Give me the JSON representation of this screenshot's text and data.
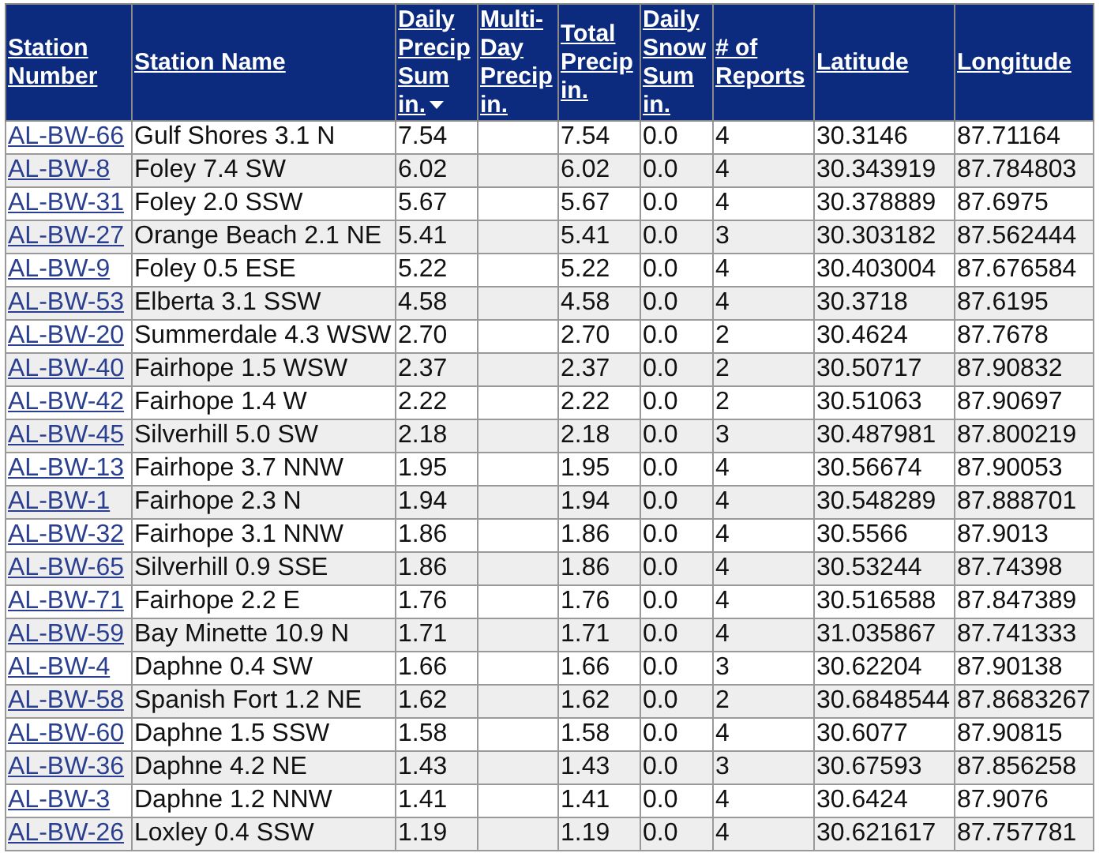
{
  "table": {
    "columns": [
      {
        "label": "Station Number",
        "sorted": false
      },
      {
        "label": "Station Name",
        "sorted": false
      },
      {
        "label": "Daily Precip Sum in.",
        "sorted": true
      },
      {
        "label": "Multi-Day Precip in.",
        "sorted": false
      },
      {
        "label": "Total Precip in.",
        "sorted": false
      },
      {
        "label": "Daily Snow Sum in.",
        "sorted": false
      },
      {
        "label": "# of Reports",
        "sorted": false
      },
      {
        "label": "Latitude",
        "sorted": false
      },
      {
        "label": "Longitude",
        "sorted": false
      }
    ],
    "rows": [
      [
        "AL-BW-66",
        "Gulf Shores 3.1 N",
        "7.54",
        null,
        "7.54",
        "0.0",
        "4",
        "30.3146",
        "87.71164"
      ],
      [
        "AL-BW-8",
        "Foley 7.4 SW",
        "6.02",
        null,
        "6.02",
        "0.0",
        "4",
        "30.343919",
        "87.784803"
      ],
      [
        "AL-BW-31",
        "Foley 2.0 SSW",
        "5.67",
        null,
        "5.67",
        "0.0",
        "4",
        "30.378889",
        "87.6975"
      ],
      [
        "AL-BW-27",
        "Orange Beach 2.1 NE",
        "5.41",
        null,
        "5.41",
        "0.0",
        "3",
        "30.303182",
        "87.562444"
      ],
      [
        "AL-BW-9",
        "Foley 0.5 ESE",
        "5.22",
        null,
        "5.22",
        "0.0",
        "4",
        "30.403004",
        "87.676584"
      ],
      [
        "AL-BW-53",
        "Elberta 3.1 SSW",
        "4.58",
        null,
        "4.58",
        "0.0",
        "4",
        "30.3718",
        "87.6195"
      ],
      [
        "AL-BW-20",
        "Summerdale 4.3 WSW",
        "2.70",
        null,
        "2.70",
        "0.0",
        "2",
        "30.4624",
        "87.7678"
      ],
      [
        "AL-BW-40",
        "Fairhope 1.5 WSW",
        "2.37",
        null,
        "2.37",
        "0.0",
        "2",
        "30.50717",
        "87.90832"
      ],
      [
        "AL-BW-42",
        "Fairhope 1.4 W",
        "2.22",
        null,
        "2.22",
        "0.0",
        "2",
        "30.51063",
        "87.90697"
      ],
      [
        "AL-BW-45",
        "Silverhill 5.0 SW",
        "2.18",
        null,
        "2.18",
        "0.0",
        "3",
        "30.487981",
        "87.800219"
      ],
      [
        "AL-BW-13",
        "Fairhope 3.7 NNW",
        "1.95",
        null,
        "1.95",
        "0.0",
        "4",
        "30.56674",
        "87.90053"
      ],
      [
        "AL-BW-1",
        "Fairhope 2.3 N",
        "1.94",
        null,
        "1.94",
        "0.0",
        "4",
        "30.548289",
        "87.888701"
      ],
      [
        "AL-BW-32",
        "Fairhope 3.1 NNW",
        "1.86",
        null,
        "1.86",
        "0.0",
        "4",
        "30.5566",
        "87.9013"
      ],
      [
        "AL-BW-65",
        "Silverhill 0.9 SSE",
        "1.86",
        null,
        "1.86",
        "0.0",
        "4",
        "30.53244",
        "87.74398"
      ],
      [
        "AL-BW-71",
        "Fairhope 2.2 E",
        "1.76",
        null,
        "1.76",
        "0.0",
        "4",
        "30.516588",
        "87.847389"
      ],
      [
        "AL-BW-59",
        "Bay Minette 10.9 N",
        "1.71",
        null,
        "1.71",
        "0.0",
        "4",
        "31.035867",
        "87.741333"
      ],
      [
        "AL-BW-4",
        "Daphne 0.4 SW",
        "1.66",
        null,
        "1.66",
        "0.0",
        "3",
        "30.62204",
        "87.90138"
      ],
      [
        "AL-BW-58",
        "Spanish Fort 1.2 NE",
        "1.62",
        null,
        "1.62",
        "0.0",
        "2",
        "30.6848544",
        "87.8683267"
      ],
      [
        "AL-BW-60",
        "Daphne 1.5 SSW",
        "1.58",
        null,
        "1.58",
        "0.0",
        "4",
        "30.6077",
        "87.90815"
      ],
      [
        "AL-BW-36",
        "Daphne 4.2 NE",
        "1.43",
        null,
        "1.43",
        "0.0",
        "3",
        "30.67593",
        "87.856258"
      ],
      [
        "AL-BW-3",
        "Daphne 1.2 NNW",
        "1.41",
        null,
        "1.41",
        "0.0",
        "4",
        "30.6424",
        "87.9076"
      ],
      [
        "AL-BW-26",
        "Loxley 0.4 SSW",
        "1.19",
        null,
        "1.19",
        "0.0",
        "4",
        "30.621617",
        "87.757781"
      ]
    ]
  }
}
